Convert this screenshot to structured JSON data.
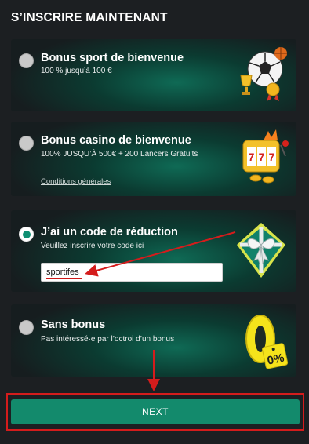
{
  "page": {
    "title": "S’INSCRIRE MAINTENANT"
  },
  "options": [
    {
      "title": "Bonus sport de bienvenue",
      "subtitle": "100 % jusqu’à 100 €",
      "selected": false
    },
    {
      "title": "Bonus casino de bienvenue",
      "subtitle": "100% JUSQU’À 500€ + 200 Lancers Gratuits",
      "link": "Conditions générales",
      "selected": false
    },
    {
      "title": "J’ai un code de réduction",
      "subtitle": "Veuillez inscrire votre code ici",
      "input_value": "sportifes",
      "selected": true
    },
    {
      "title": "Sans bonus",
      "subtitle": "Pas intéressé·e par l’octroi d’un bonus",
      "badge": "0%",
      "selected": false
    }
  ],
  "next_button": {
    "label": "NEXT"
  },
  "colors": {
    "accent": "#138a6c",
    "annotation": "#d41c1c",
    "background": "#1c1f22"
  },
  "icons": [
    "sports-bonus-icon",
    "slot-machine-icon",
    "gift-box-icon",
    "zero-percent-icon"
  ]
}
